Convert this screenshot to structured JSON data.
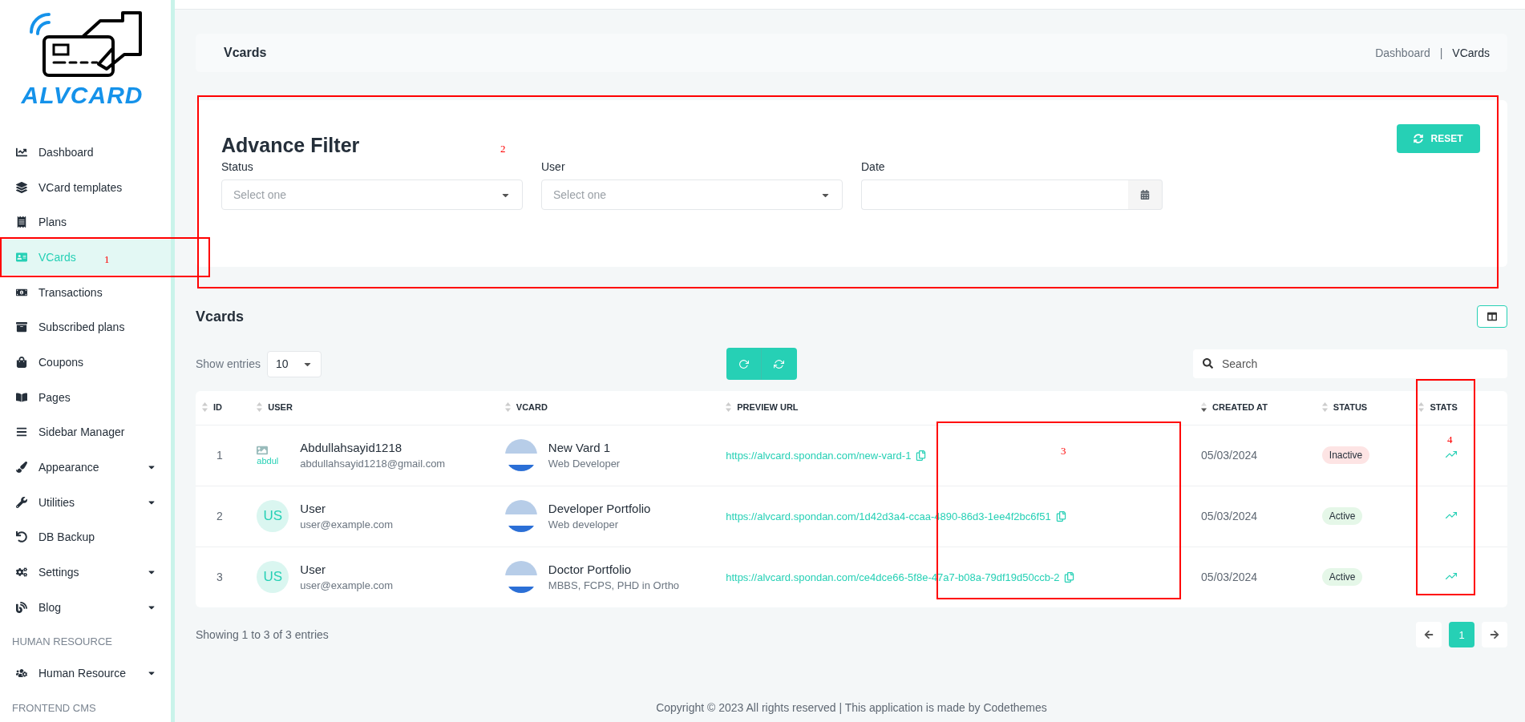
{
  "logo": {
    "text": "ALVCARD"
  },
  "sidebar": {
    "items": [
      {
        "kind": "item",
        "label": "Dashboard",
        "selected": false,
        "expandable": false
      },
      {
        "kind": "item",
        "label": "VCard templates",
        "selected": false,
        "expandable": false
      },
      {
        "kind": "item",
        "label": "Plans",
        "selected": false,
        "expandable": false
      },
      {
        "kind": "item",
        "label": "VCards",
        "selected": true,
        "expandable": false
      },
      {
        "kind": "item",
        "label": "Transactions",
        "selected": false,
        "expandable": false
      },
      {
        "kind": "item",
        "label": "Subscribed plans",
        "selected": false,
        "expandable": false
      },
      {
        "kind": "item",
        "label": "Coupons",
        "selected": false,
        "expandable": false
      },
      {
        "kind": "item",
        "label": "Pages",
        "selected": false,
        "expandable": false
      },
      {
        "kind": "item",
        "label": "Sidebar Manager",
        "selected": false,
        "expandable": false
      },
      {
        "kind": "item",
        "label": "Appearance",
        "selected": false,
        "expandable": true
      },
      {
        "kind": "item",
        "label": "Utilities",
        "selected": false,
        "expandable": true
      },
      {
        "kind": "item",
        "label": "DB Backup",
        "selected": false,
        "expandable": false
      },
      {
        "kind": "item",
        "label": "Settings",
        "selected": false,
        "expandable": true
      },
      {
        "kind": "item",
        "label": "Blog",
        "selected": false,
        "expandable": true
      },
      {
        "kind": "heading",
        "label": "HUMAN RESOURCE"
      },
      {
        "kind": "item",
        "label": "Human Resource",
        "selected": false,
        "expandable": true
      },
      {
        "kind": "heading",
        "label": "FRONTEND CMS"
      }
    ]
  },
  "breadcrumb": {
    "title": "Vcards",
    "links": [
      "Dashboard",
      "VCards"
    ],
    "separator": "|"
  },
  "filter": {
    "title": "Advance Filter",
    "reset_label": "RESET",
    "fields": [
      {
        "kind": "select",
        "label": "Status",
        "placeholder": "Select one"
      },
      {
        "kind": "select",
        "label": "User",
        "placeholder": "Select one"
      },
      {
        "kind": "date",
        "label": "Date"
      }
    ]
  },
  "vcards": {
    "title": "Vcards",
    "show_entries_label": "Show entries",
    "page_size": "10",
    "search_placeholder": "Search",
    "columns": [
      {
        "label": "ID",
        "sorted": false
      },
      {
        "label": "USER",
        "sorted": false
      },
      {
        "label": "VCARD",
        "sorted": false
      },
      {
        "label": "PREVIEW URL",
        "sorted": false
      },
      {
        "label": "CREATED AT",
        "sorted": true
      },
      {
        "label": "STATUS",
        "sorted": false
      },
      {
        "label": "STATS",
        "sorted": false
      }
    ],
    "rows": [
      {
        "id": "1",
        "user": {
          "kind": "image",
          "name": "Abdullahsayid1218",
          "email": "abdullahsayid1218@gmail.com",
          "avatar_text": "abdul"
        },
        "vcard": {
          "name": "New Vard 1",
          "subtitle": "Web Developer"
        },
        "url": "https://alvcard.spondan.com/new-vard-1",
        "created": "05/03/2024",
        "status": {
          "label": "Inactive",
          "active": false
        }
      },
      {
        "id": "2",
        "user": {
          "kind": "initials",
          "name": "User",
          "email": "user@example.com",
          "avatar_text": "US"
        },
        "vcard": {
          "name": "Developer Portfolio",
          "subtitle": "Web developer"
        },
        "url": "https://alvcard.spondan.com/1d42d3a4-ccaa-4890-86d3-1ee4f2bc6f51",
        "created": "05/03/2024",
        "status": {
          "label": "Active",
          "active": true
        }
      },
      {
        "id": "3",
        "user": {
          "kind": "initials",
          "name": "User",
          "email": "user@example.com",
          "avatar_text": "US"
        },
        "vcard": {
          "name": "Doctor Portfolio",
          "subtitle": "MBBS, FCPS, PHD in Ortho"
        },
        "url": "https://alvcard.spondan.com/ce4dce66-5f8e-47a7-b08a-79df19d50ccb-2",
        "created": "05/03/2024",
        "status": {
          "label": "Active",
          "active": true
        }
      }
    ],
    "summary": "Showing 1 to 3 of 3 entries",
    "pages": [
      {
        "label": "1",
        "selected": true
      }
    ]
  },
  "footer": "Copyright © 2023 All rights reserved | This application is made by Codethemes",
  "annotations": [
    {
      "label": "1"
    },
    {
      "label": "2"
    },
    {
      "label": "3"
    },
    {
      "label": "4"
    }
  ]
}
